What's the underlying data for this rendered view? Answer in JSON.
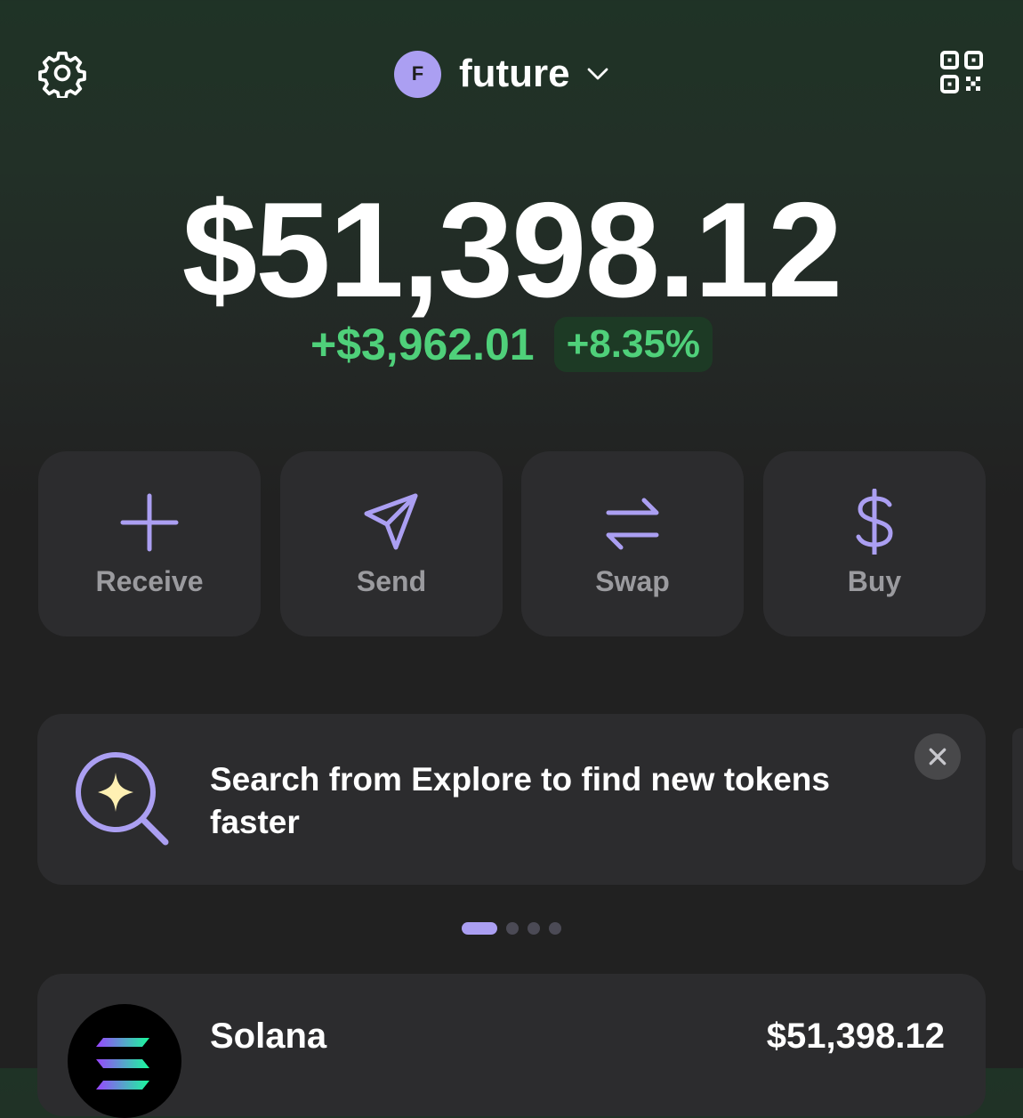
{
  "header": {
    "avatar_initial": "F",
    "account_name": "future",
    "settings_icon": "gear-icon",
    "qr_icon": "qr-code-icon",
    "dropdown_icon": "chevron-down-icon"
  },
  "balance": {
    "total": "$51,398.12",
    "change_amount": "+$3,962.01",
    "change_percent": "+8.35%"
  },
  "actions": [
    {
      "label": "Receive",
      "icon": "plus-icon"
    },
    {
      "label": "Send",
      "icon": "send-icon"
    },
    {
      "label": "Swap",
      "icon": "swap-icon"
    },
    {
      "label": "Buy",
      "icon": "dollar-icon"
    }
  ],
  "banner": {
    "text": "Search from Explore to find new tokens faster",
    "icon": "search-sparkle-icon",
    "close_icon": "close-icon"
  },
  "pager": {
    "total": 4,
    "active": 1
  },
  "tokens": [
    {
      "name": "Solana",
      "value": "$51,398.12",
      "icon": "solana-logo"
    }
  ],
  "colors": {
    "accent": "#ab9ff2",
    "positive": "#4fd07a",
    "card": "#2c2c2e"
  }
}
